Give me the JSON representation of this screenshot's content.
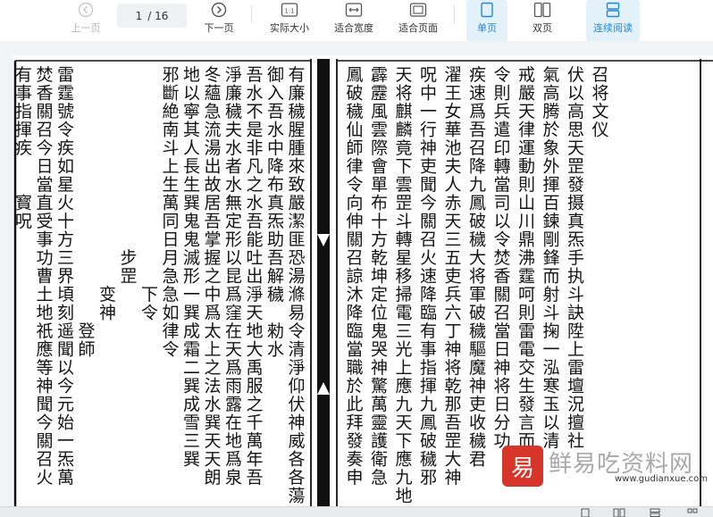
{
  "toolbar": {
    "prev_label": "上一页",
    "next_label": "下一页",
    "current_page": "1",
    "total_pages": "/ 16",
    "actual_size_label": "实际大小",
    "fit_width_label": "适合宽度",
    "fit_page_label": "适合页面",
    "single_page_label": "单页",
    "double_page_label": "双页",
    "continuous_label": "连续阅读",
    "actual_size_icon_text": "1:1"
  },
  "document": {
    "columns_right_page": [
      "召将文仪",
      "伏以高思天罡發摄真炁手执斗訣陞上雷壇況擅社",
      "氣高腾於象外揮百鍊剛鋒而射斗掬一泓寒玉以清",
      "戒嚴天律運動則山川鼎沸霆呵則雷電交生發言而",
      "令則兵遣印轉當司以令焚香關召當日神将日分功",
      "疾速爲吾召降九鳳破穢大将軍破穢驅魔神吏收穢君",
      "濯王女華池夫人赤天三五吏兵六丁神将乾那吾罡大神",
      "呪中一行神吏聞今關召火速降臨有事指揮九鳳破穢邪",
      "天将麒麟竟下雲罡斗轉星移掃電三光上應九天下應九地",
      "霹靂風雲際會單布十方乾坤定位鬼哭神驚萬靈護衛急",
      "鳳破穢仙師律令向伸關召諒沐降臨當職於此拜發奏申"
    ],
    "columns_left_page": [
      "有廉穢腥腫來致嚴潔匪恐湯滌易令清淨仰伏神威各各蕩",
      "御入吾水中降布真炁助吾解穢　勑水",
      "吾水不是非凡之水吾能吐出淨天地大禹服之千萬年吾",
      "淨廉穢夫水者水無定形以昆爲窪在天爲雨露在地爲泉",
      "冬蘊急流湯出故居吾掌握之中爲太上之法水巽天天朗",
      "地以寧其人長生巽鬼鬼滅形一巽成霜二巽成雪三巽",
      "邪斷絶南斗上生萬同日月急急如律令",
      "　　　　　　　　　　　　下令",
      "　　　　　　　　　　步罡",
      "　　　　　　　　　　　　变神",
      "　　　　　　　　　　　　　　登師",
      "雷霆號令疾如星火十方三界頃刻遥聞以今元始一炁萬",
      "焚香關召今日當直受事功曹土地祇應等神聞今關召火",
      "有事指揮疾　　寳呪"
    ]
  },
  "watermark": {
    "seal_char": "易",
    "site_name": "鲜易吃资料网",
    "url": "www.gudianxue.com"
  }
}
